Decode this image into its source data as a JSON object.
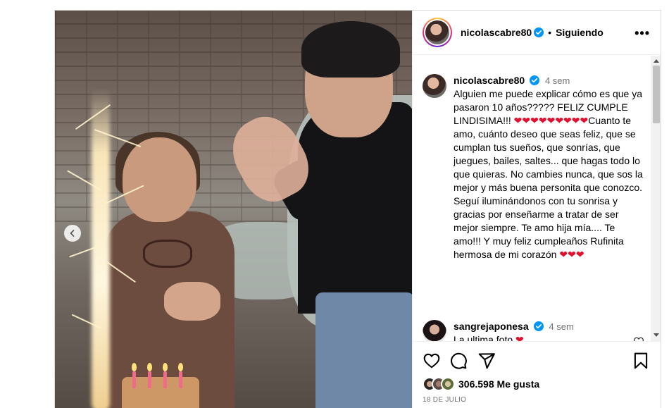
{
  "post": {
    "username": "nicolascabre80",
    "follow_state": "Siguiendo",
    "separator": "•",
    "more_label": "•••"
  },
  "caption": {
    "username": "nicolascabre80",
    "time": "4 sem",
    "text": "Alguien me puede explicar cómo es que ya pasaron 10 años????? FELIZ CUMPLE LINDISIMA!!! ❤️❤️❤️❤️❤️❤️❤️❤️❤️Cuanto te amo, cuánto deseo que seas feliz, que se cumplan tus sueños, que sonrías, que juegues, bailes, saltes... que hagas todo lo que quieras. No cambies nunca, que sos la mejor y más buena personita que conozco. Seguí iluminándonos con tu sonrisa y gracias por enseñarme a tratar de ser mejor siempre. Te amo hija mía.... Te amo!!! Y muy feliz cumpleaños Rufinita hermosa de mi corazón ❤️❤️❤️"
  },
  "comment": {
    "username": "sangrejaponesa",
    "time": "4 sem",
    "text": "La ultima foto ❤️"
  },
  "engagement": {
    "likes": "306.598 Me gusta",
    "date": "18 DE JULIO"
  },
  "icons": {
    "heart": "heart-icon",
    "comment": "comment-icon",
    "share": "share-icon",
    "save": "bookmark-icon",
    "prev": "chevron-left-icon",
    "verified": "verified-badge-icon"
  },
  "colors": {
    "verified": "#0095f6",
    "heart_emoji": "#e0102e",
    "muted_text": "#737373"
  }
}
